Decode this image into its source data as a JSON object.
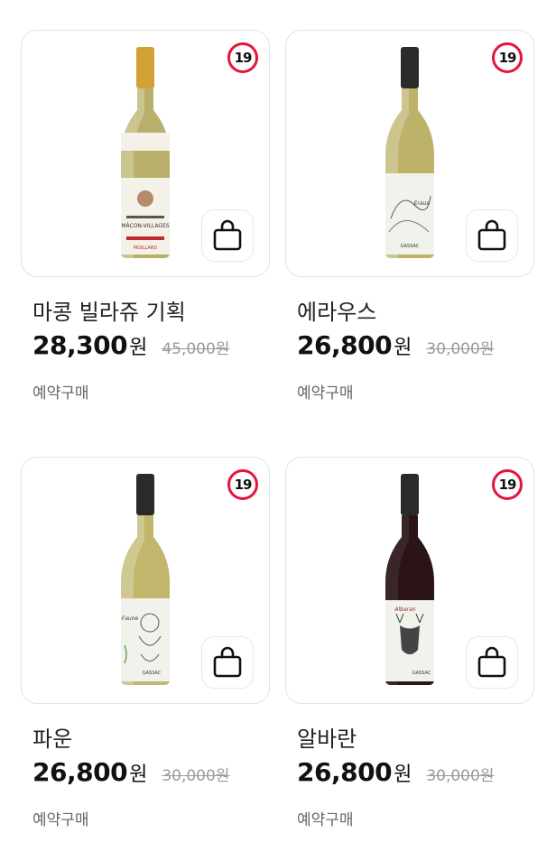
{
  "products": [
    {
      "name": "마콩 빌라쥬 기획",
      "price": "28,300",
      "currency": "원",
      "original_price": "45,000원",
      "tag": "예약구매",
      "age_badge": "19",
      "wine_type": "white",
      "bottle_label": "MÂCON-VILLAGES",
      "bottle_brand": "MOILLARD",
      "cap_color": "#d2a033",
      "glass_color": "#b8b06a",
      "label_color": "#f4f1e8"
    },
    {
      "name": "에라우스",
      "price": "26,800",
      "currency": "원",
      "original_price": "30,000원",
      "tag": "예약구매",
      "age_badge": "19",
      "wine_type": "white",
      "bottle_label": "Eraus",
      "bottle_brand": "GASSAC",
      "cap_color": "#2a2a2a",
      "glass_color": "#bdb26a",
      "label_color": "#f2f2ec"
    },
    {
      "name": "파운",
      "price": "26,800",
      "currency": "원",
      "original_price": "30,000원",
      "tag": "예약구매",
      "age_badge": "19",
      "wine_type": "white",
      "bottle_label": "Faune",
      "bottle_brand": "GASSAC",
      "cap_color": "#2a2a2a",
      "glass_color": "#c1b66c",
      "label_color": "#f2f2ec"
    },
    {
      "name": "알바란",
      "price": "26,800",
      "currency": "원",
      "original_price": "30,000원",
      "tag": "예약구매",
      "age_badge": "19",
      "wine_type": "red",
      "bottle_label": "Albaran",
      "bottle_brand": "GASSAC",
      "cap_color": "#2a2a2a",
      "glass_color": "#2a1416",
      "label_color": "#f2f2ec"
    }
  ],
  "colors": {
    "age_badge_ring": "#e8143c",
    "border": "#e3e3e3",
    "strike_price": "#9a9a9a"
  }
}
